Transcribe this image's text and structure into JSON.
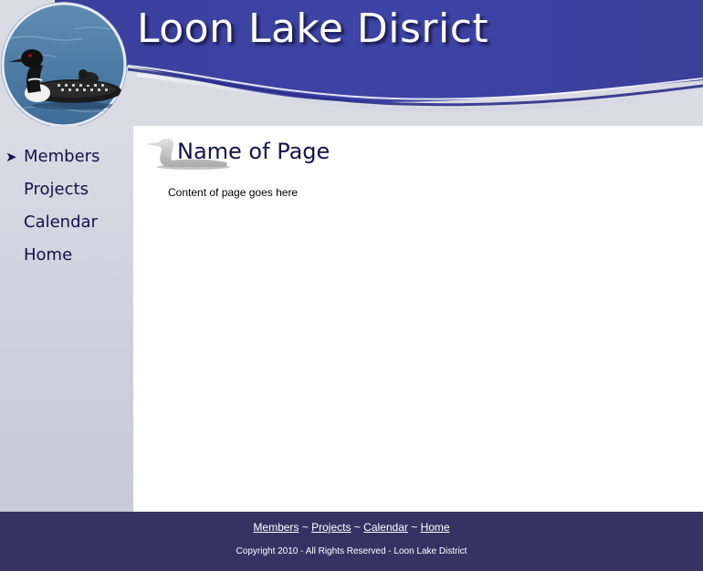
{
  "header": {
    "site_title": "Loon Lake Disrict",
    "logo_image": "loon-on-lake-photo"
  },
  "nav": {
    "items": [
      {
        "label": "Members",
        "active": true
      },
      {
        "label": "Projects",
        "active": false
      },
      {
        "label": "Calendar",
        "active": false
      },
      {
        "label": "Home",
        "active": false
      }
    ],
    "active_marker": "➤"
  },
  "main": {
    "heading": "Name of Page",
    "content": "Content of page goes here"
  },
  "footer": {
    "links": [
      "Members",
      "Projects",
      "Calendar",
      "Home"
    ],
    "separator": " ~ ",
    "copyright": "Copyright 2010 - All Rights Reserved - Loon Lake District"
  },
  "colors": {
    "header_blue": "#3a3f9a",
    "nav_text": "#14124a",
    "footer_bg": "#363363",
    "sidebar_bg": "#d0d3de"
  }
}
